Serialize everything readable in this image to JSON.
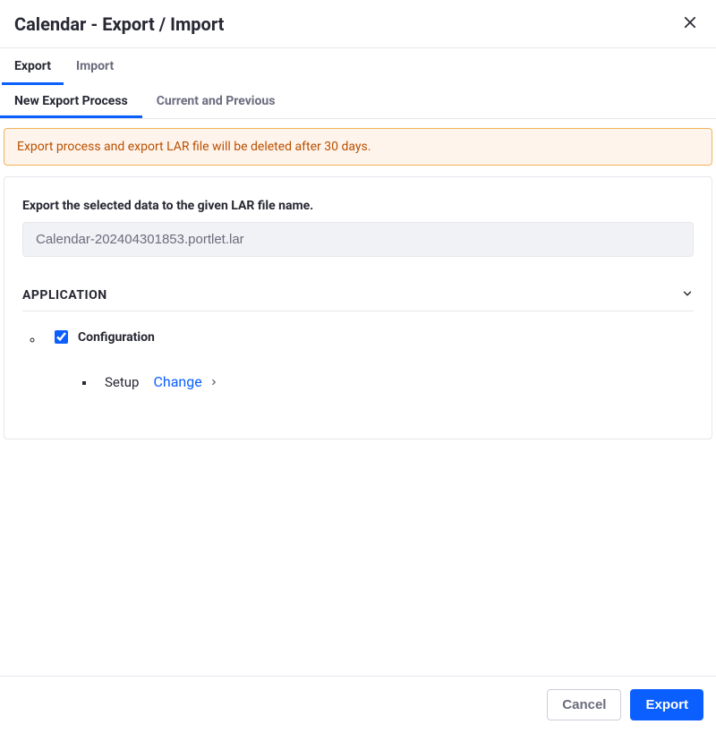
{
  "header": {
    "title": "Calendar - Export / Import"
  },
  "primaryTabs": {
    "export": "Export",
    "import": "Import"
  },
  "subTabs": {
    "newProcess": "New Export Process",
    "currentPrevious": "Current and Previous"
  },
  "alert": {
    "message": "Export process and export LAR file will be deleted after 30 days."
  },
  "form": {
    "heading": "Export the selected data to the given LAR file name.",
    "filename": "Calendar-202404301853.portlet.lar"
  },
  "section": {
    "application": {
      "title": "APPLICATION",
      "configuration_label": "Configuration",
      "setup_label": "Setup",
      "change_label": "Change"
    }
  },
  "footer": {
    "cancel": "Cancel",
    "export": "Export"
  }
}
